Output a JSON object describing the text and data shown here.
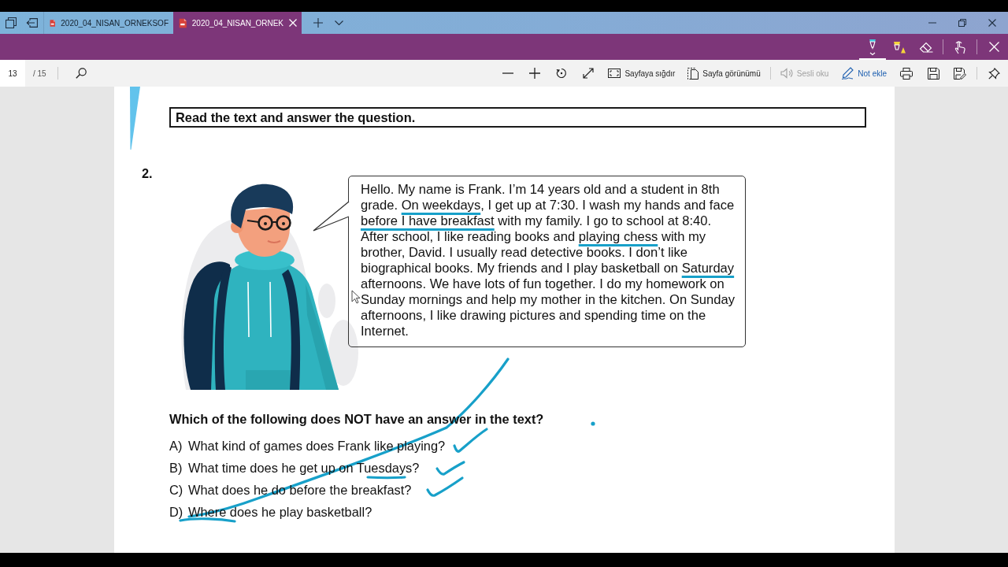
{
  "window": {
    "tabs": [
      {
        "title": "2020_04_NISAN_ORNEKSOF",
        "selected": false
      },
      {
        "title": "2020_04_NISAN_ORNEK",
        "selected": true
      }
    ]
  },
  "ink_tools": [
    {
      "kind": "pen",
      "selected": true
    },
    {
      "kind": "highlighter",
      "selected": false
    },
    {
      "kind": "eraser",
      "selected": false
    }
  ],
  "toolbar": {
    "page": "13",
    "page_total": "/ 15",
    "button_groups": [
      [
        {
          "kind": "zoom_out",
          "disabled": false
        },
        {
          "kind": "zoom_in",
          "disabled": false
        },
        {
          "kind": "rotate",
          "disabled": false
        },
        {
          "kind": "fullscreen",
          "disabled": false
        },
        {
          "kind": "fit_page",
          "label": "Sayfaya sığdır",
          "disabled": false
        },
        {
          "kind": "page_view",
          "label": "Sayfa görünümü",
          "disabled": false
        }
      ],
      [
        {
          "kind": "read_aloud",
          "label": "Sesli oku",
          "disabled": true
        },
        {
          "kind": "add_note",
          "label": "Not ekle",
          "disabled": false
        },
        {
          "kind": "print",
          "disabled": false
        },
        {
          "kind": "save",
          "disabled": false
        },
        {
          "kind": "save_as",
          "disabled": false
        }
      ],
      [
        {
          "kind": "pin",
          "disabled": false
        }
      ]
    ]
  },
  "document": {
    "instruction": "Read the text and answer the question.",
    "question_number": "2.",
    "passage": [
      {
        "text": "Hello. My name is Frank. I’m 14 years old and a student in 8th grade. ",
        "underlined": false
      },
      {
        "text": "On weekdays",
        "underlined": true
      },
      {
        "text": ", I get up at 7:30. I wash my hands and face ",
        "underlined": false
      },
      {
        "text": "before I have breakfast",
        "underlined": true
      },
      {
        "text": " with my family. I go to school at 8:40. After school, I like reading books and ",
        "underlined": false
      },
      {
        "text": "playing chess",
        "underlined": true
      },
      {
        "text": " with my brother, David. I usually read detective books. I don’t like biographical books. My friends and I play basketball on ",
        "underlined": false
      },
      {
        "text": "Saturday",
        "underlined": true
      },
      {
        "text": " afternoons. We have lots of fun together. I do my homework on Sunday mornings and help my mother in the kitchen. On Sunday afternoons, I like drawing pictures and spending time on the Internet.",
        "underlined": false
      }
    ],
    "question": "Which of the following does NOT have an answer in the text?",
    "options": [
      {
        "letter": "A)",
        "text": "What kind of games does Frank like playing?"
      },
      {
        "letter": "B)",
        "text": "What time does he get up on Tuesdays?"
      },
      {
        "letter": "C)",
        "text": "What does he do before the breakfast?"
      },
      {
        "letter": "D)",
        "text": "Where does he play basketball?"
      }
    ]
  }
}
